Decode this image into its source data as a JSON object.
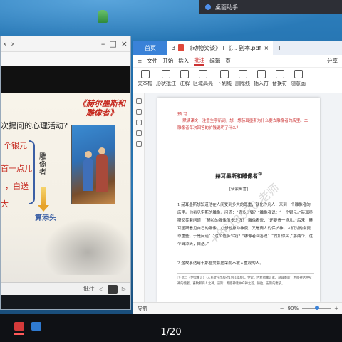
{
  "desktop": {
    "assistant_label": "桌面助手"
  },
  "left_window": {
    "slide": {
      "title_line1": "《赫尔墨斯和",
      "title_line2": "雕像者》",
      "question": "次提问的心理活动?",
      "note1": "个银元",
      "note2": "首一点儿",
      "note3": "，白送",
      "note4": "大",
      "sculptor": "雕像者",
      "result": "算添头"
    },
    "bottom_label": "批注"
  },
  "right_window": {
    "tabs": {
      "home": "首页",
      "doc_number": "3",
      "doc": "《动物笑谈》+《... 副本.pdf",
      "close": "×",
      "add": "+"
    },
    "menu": [
      "文件",
      "开始",
      "插入",
      "批注",
      "编辑",
      "页"
    ],
    "menu_active": "批注",
    "share": "分享",
    "ribbon": [
      "文本框",
      "形状批注",
      "注解",
      "区域高亮",
      "下划线",
      "删除线",
      "插入符",
      "替换符",
      "随意画"
    ],
    "page": {
      "preview_label": "预 习",
      "preview_text": "一 默读课文，注意生字新词，想一想赫耳墨斯为什么要去雕像者的店里。二 雕像者每次回答的价钱说明了什么？",
      "title": "赫耳墨斯和雕像者",
      "title_note": "①",
      "author": "[伊索寓言]",
      "para1": "1 赫耳墨斯想知道他在人间受到多大的尊重，就化作凡人，来到一个雕像者的店里。他看见宙斯的雕像，问道：“值多少钱？”雕像者说：“一个银元。”赫耳墨斯又笑着问道：“赫拉的雕像值多少钱？”雕像者说：“还要贵一点儿。”后来，赫耳墨斯看见自己的雕像，心想他身为神使，又是商人的保护神，人们对他会更尊重些，于是问道：“这个值多少钱？”雕像者回答说：“假如你买了那两个，这个算添头，白送。”",
      "para2": "2 这故事适用于那些爱慕虚荣而不被人重视的人。",
      "footnotes": "① 选自《伊索寓言》（人民文学出版社1981年版）。伊索，古希腊寓言家。赫耳墨斯，希腊神话中众神的使者，畜牧和商人之神。宙斯，希腊神话中众神之首。赫拉，宙斯的妻子。",
      "watermark": "+8618570 老师"
    },
    "status": {
      "nav": "导航",
      "zoom": "90%"
    }
  },
  "taskbar": {
    "page_counter": "1/20"
  }
}
